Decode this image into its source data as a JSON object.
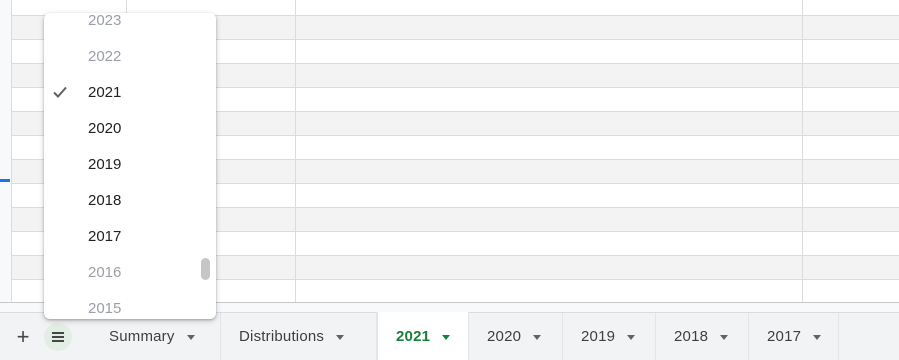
{
  "sheet_menu": {
    "items": [
      {
        "label": "2023",
        "checked": false,
        "dimmed": true
      },
      {
        "label": "2022",
        "checked": false,
        "dimmed": true
      },
      {
        "label": "2021",
        "checked": true,
        "dimmed": false
      },
      {
        "label": "2020",
        "checked": false,
        "dimmed": false
      },
      {
        "label": "2019",
        "checked": false,
        "dimmed": false
      },
      {
        "label": "2018",
        "checked": false,
        "dimmed": false
      },
      {
        "label": "2017",
        "checked": false,
        "dimmed": false
      },
      {
        "label": "2016",
        "checked": false,
        "dimmed": true
      },
      {
        "label": "2015",
        "checked": false,
        "dimmed": true
      }
    ]
  },
  "tab_bar": {
    "add_icon": "plus-icon",
    "all_sheets_icon": "list-icon",
    "tabs": [
      {
        "label": "Summary",
        "active": false
      },
      {
        "label": "Distributions",
        "active": false
      },
      {
        "label": "2021",
        "active": true
      },
      {
        "label": "2020",
        "active": false
      },
      {
        "label": "2019",
        "active": false
      },
      {
        "label": "2018",
        "active": false
      },
      {
        "label": "2017",
        "active": false
      }
    ]
  },
  "colors": {
    "active_tab_text": "#188038",
    "selection_marker": "#1a73e8",
    "shaded_row": "#f3f3f3",
    "tab_bar_bg": "#f1f3f4"
  }
}
